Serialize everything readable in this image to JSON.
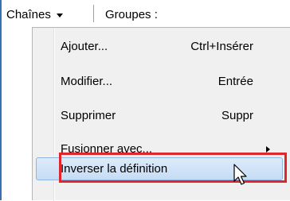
{
  "menubar": {
    "chaines_label": "Chaînes",
    "groupes_label": "Groupes :"
  },
  "menu": {
    "items": [
      {
        "label": "Ajouter...",
        "shortcut": "Ctrl+Insérer"
      },
      {
        "label": "Modifier...",
        "shortcut": "Entrée"
      },
      {
        "label": "Supprimer",
        "shortcut": "Suppr"
      },
      {
        "label": "Fusionner avec...",
        "shortcut": ""
      },
      {
        "label": "Inverser la définition",
        "shortcut": ""
      }
    ],
    "highlighted_index": 4
  },
  "colors": {
    "highlight_border": "#8fb5e2",
    "callout_frame": "#e0262c"
  }
}
